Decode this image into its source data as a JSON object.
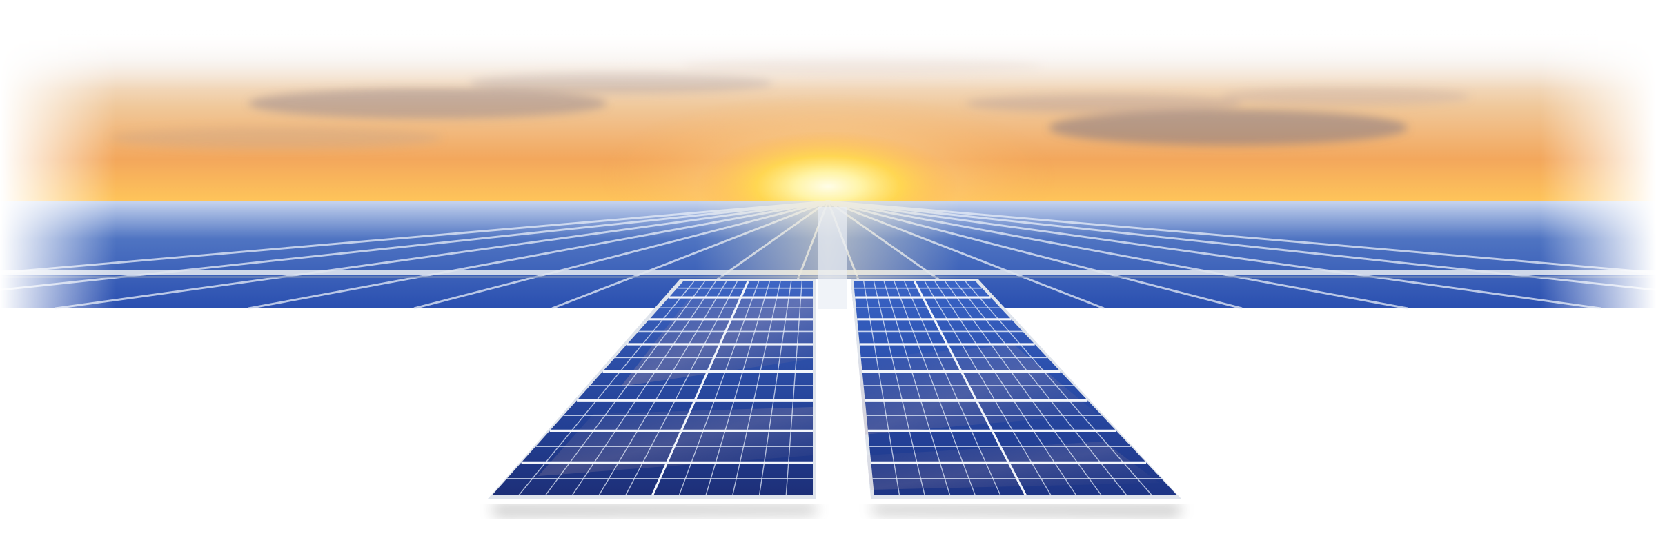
{
  "scene": {
    "description_visible_text": "",
    "colors": {
      "background": "#ffffff",
      "sky_top": "#f3ece6",
      "sky_mid": "#f2b36e",
      "sky_horizon": "#ffcf5a",
      "sun_core": "#fff8c8",
      "sun_glow": "#ffd23a",
      "cloud_dark": "#9a8f9a",
      "panel_deep": "#1c2f7a",
      "panel_mid": "#2c4fa8",
      "panel_light": "#9fb6df",
      "panel_grid": "#e4ecfa",
      "frame_silver": "#d9dee6",
      "rail_light": "#eef2f7"
    }
  }
}
